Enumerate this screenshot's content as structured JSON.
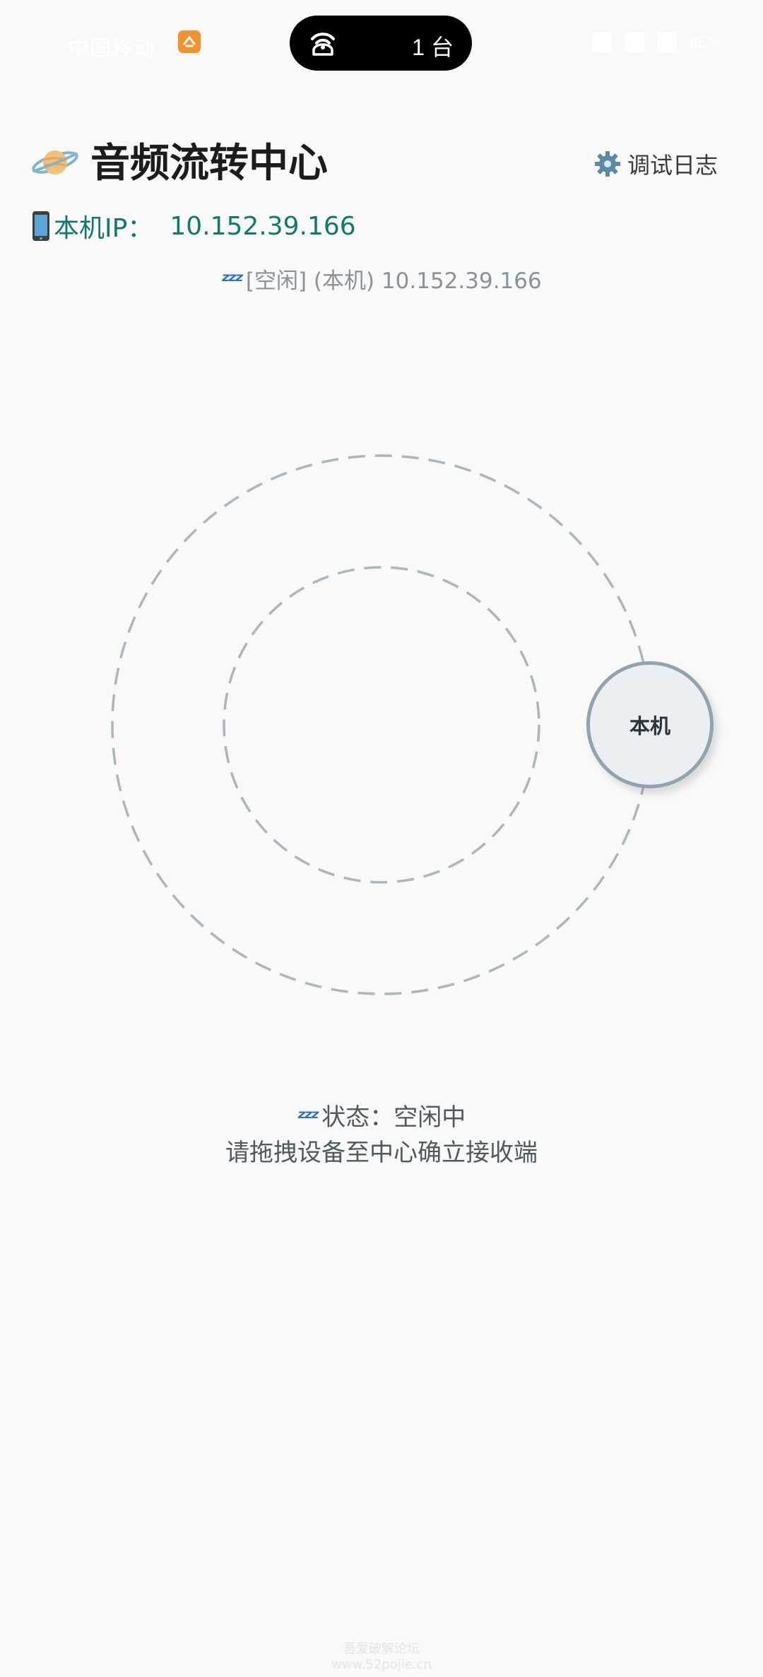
{
  "status_bar": {
    "left_text": "中国移动",
    "pill_count": "1 台",
    "right_text": "85%"
  },
  "header": {
    "title": "音频流转中心",
    "debug_label": "调试日志"
  },
  "ip": {
    "label": "本机IP：",
    "value": "10.152.39.166"
  },
  "connection": {
    "zzz": "ᶻᶻᶻ",
    "text": "[空闲] (本机) 10.152.39.166"
  },
  "orbit": {
    "local_node_label": "本机"
  },
  "status": {
    "zzz": "ᶻᶻᶻ",
    "text": "状态：空闲中",
    "hint": "请拖拽设备至中心确立接收端"
  },
  "watermark": {
    "line1": "吾爱破解论坛",
    "line2": "www.52pojie.cn"
  },
  "colors": {
    "background": "#f9f9fa",
    "accent_teal": "#0f7a6a",
    "ring": "#aab7bd",
    "node_border": "#90a4ad"
  }
}
